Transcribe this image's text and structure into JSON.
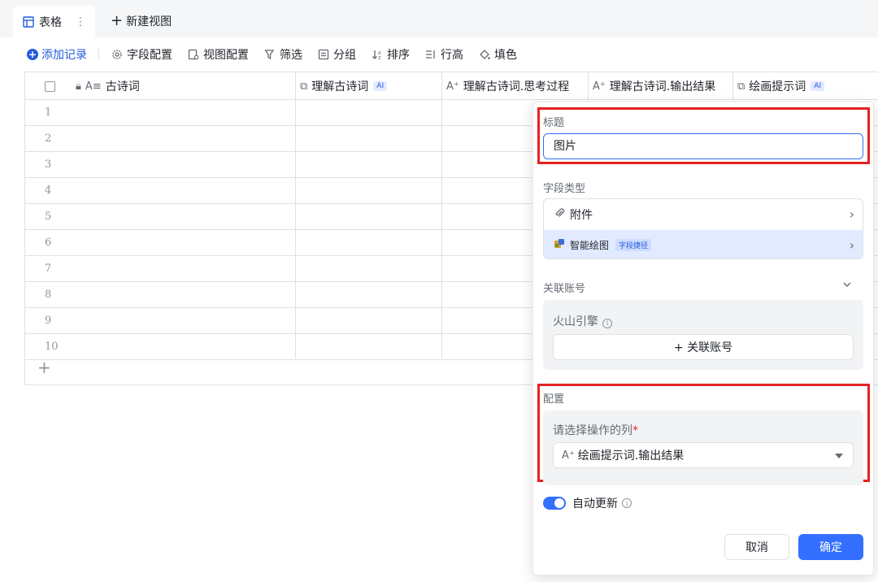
{
  "tabs": {
    "active_label": "表格",
    "new_view_label": "新建视图"
  },
  "toolbar": {
    "add_record": "添加记录",
    "field_config": "字段配置",
    "view_config": "视图配置",
    "filter": "筛选",
    "group": "分组",
    "sort": "排序",
    "row_height": "行高",
    "fill_color": "填色"
  },
  "grid": {
    "columns": [
      {
        "label": "古诗词",
        "icon": "text-lock-icon",
        "ai": false
      },
      {
        "label": "理解古诗词",
        "icon": "link-icon",
        "ai": true,
        "ai_label": "AI"
      },
      {
        "label": "理解古诗词.思考过程",
        "icon": "ai-text-icon",
        "ai": false
      },
      {
        "label": "理解古诗词.输出结果",
        "icon": "ai-text-icon",
        "ai": false
      },
      {
        "label": "绘画提示词",
        "icon": "link-icon",
        "ai": true,
        "ai_label": "AI"
      }
    ],
    "rows": [
      "1",
      "2",
      "3",
      "4",
      "5",
      "6",
      "7",
      "8",
      "9",
      "10"
    ]
  },
  "panel": {
    "title_label": "标题",
    "title_value": "图片",
    "field_type_label": "字段类型",
    "type_attachment": "附件",
    "type_ai_drawing": "智能绘图",
    "type_ai_drawing_tag": "字段捷径",
    "linked_account_label": "关联账号",
    "engine_name": "火山引擎",
    "link_account_button": "+ 关联账号",
    "config_label": "配置",
    "column_select_label": "请选择操作的列",
    "column_select_value": "绘画提示词.输出结果",
    "auto_update_label": "自动更新",
    "auto_update_on": true,
    "cancel": "取消",
    "confirm": "确定"
  },
  "colors": {
    "primary": "#3370ff",
    "highlight": "#e32222"
  }
}
